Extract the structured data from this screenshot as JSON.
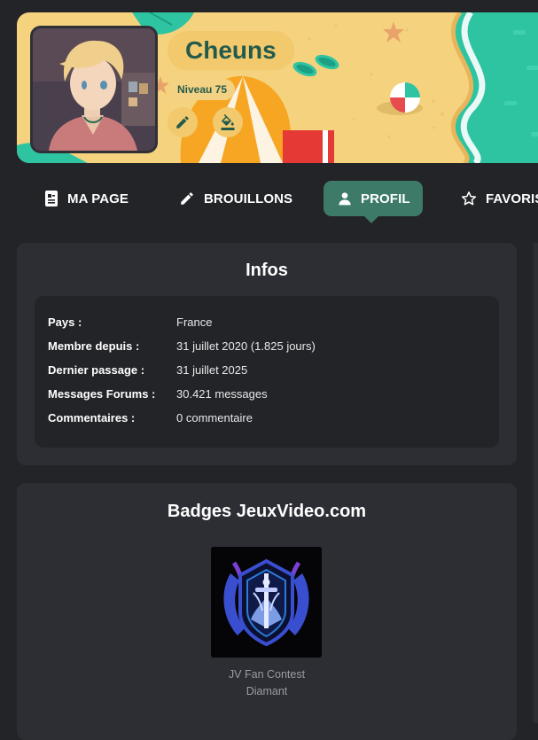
{
  "profile": {
    "pseudo": "Cheuns",
    "level": "Niveau 75",
    "edit_icon": "pencil-icon",
    "paint_icon": "paint-bucket-icon"
  },
  "tabs": [
    {
      "label": "MA PAGE",
      "icon": "page-icon",
      "active": false
    },
    {
      "label": "BROUILLONS",
      "icon": "pencil-icon",
      "active": false
    },
    {
      "label": "PROFIL",
      "icon": "person-icon",
      "active": true
    },
    {
      "label": "FAVORIS",
      "icon": "star-icon",
      "active": false
    }
  ],
  "infos": {
    "title": "Infos",
    "rows": [
      {
        "label": "Pays :",
        "value": "France"
      },
      {
        "label": "Membre depuis :",
        "value": "31 juillet 2020 (1.825 jours)"
      },
      {
        "label": "Dernier passage :",
        "value": "31 juillet 2025"
      },
      {
        "label": "Messages Forums :",
        "value": "30.421 messages"
      },
      {
        "label": "Commentaires :",
        "value": "0 commentaire"
      }
    ]
  },
  "badges": {
    "title": "Badges JeuxVideo.com",
    "items": [
      {
        "name_line1": "JV Fan Contest",
        "name_line2": "Diamant"
      }
    ]
  },
  "colors": {
    "page_bg": "#232428",
    "card_bg": "#2d2e34",
    "accent": "#3d7a68",
    "sand": "#f5d27e",
    "sea": "#2ec4a2"
  }
}
